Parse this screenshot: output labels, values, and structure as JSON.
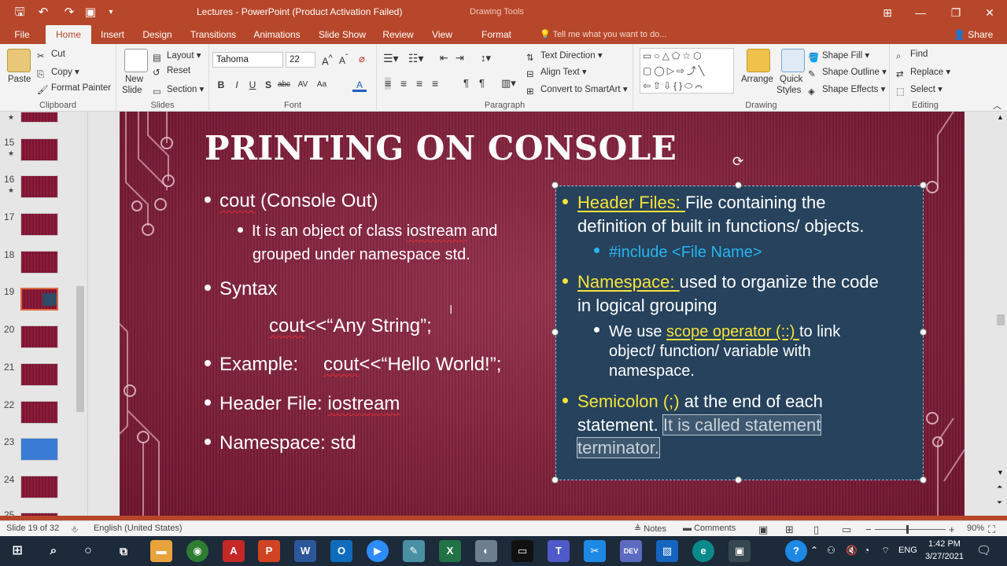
{
  "window": {
    "title": "Lectures - PowerPoint (Product Activation Failed)",
    "context_tab_group": "Drawing Tools",
    "controls": [
      "⊞",
      "—",
      "❐",
      "✕"
    ]
  },
  "tabs": [
    {
      "label": "File"
    },
    {
      "label": "Home"
    },
    {
      "label": "Insert"
    },
    {
      "label": "Design"
    },
    {
      "label": "Transitions"
    },
    {
      "label": "Animations"
    },
    {
      "label": "Slide Show"
    },
    {
      "label": "Review"
    },
    {
      "label": "View"
    },
    {
      "label": "Format"
    }
  ],
  "tell_me": "Tell me what you want to do...",
  "share": "Share",
  "ribbon": {
    "clipboard": {
      "paste": "Paste",
      "cut": "Cut",
      "copy": "Copy",
      "format_painter": "Format Painter",
      "label": "Clipboard"
    },
    "slides": {
      "new_slide": "New",
      "new_slide2": "Slide",
      "layout": "Layout",
      "reset": "Reset",
      "section": "Section",
      "label": "Slides"
    },
    "font": {
      "name": "Tahoma",
      "size": "22",
      "label": "Font"
    },
    "paragraph": {
      "text_direction": "Text Direction",
      "align_text": "Align Text",
      "smartart": "Convert to SmartArt",
      "label": "Paragraph"
    },
    "drawing": {
      "arrange": "Arrange",
      "quick_styles": "Quick",
      "quick_styles2": "Styles",
      "shape_fill": "Shape Fill",
      "shape_outline": "Shape Outline",
      "shape_effects": "Shape Effects",
      "label": "Drawing"
    },
    "editing": {
      "find": "Find",
      "replace": "Replace",
      "select": "Select",
      "label": "Editing"
    }
  },
  "thumbnails": [
    {
      "num": "15",
      "star": "★"
    },
    {
      "num": "16",
      "star": "★"
    },
    {
      "num": "17"
    },
    {
      "num": "18"
    },
    {
      "num": "19"
    },
    {
      "num": "20"
    },
    {
      "num": "21"
    },
    {
      "num": "22"
    },
    {
      "num": "23"
    },
    {
      "num": "24"
    },
    {
      "num": "25"
    }
  ],
  "selected_slide": "19",
  "slide": {
    "title": "PRINTING ON CONSOLE",
    "left": {
      "cout_word": "cout",
      "cout_rest": " (Console Out)",
      "obj_line1a": "It is an object of class ",
      "obj_line1b": "iostream",
      "obj_line1c": " and",
      "obj_line2": "grouped under namespace std.",
      "syntax": "Syntax",
      "syntax_code_a": "cout",
      "syntax_code_b": "<<“Any String”;",
      "example_label": "Example:",
      "example_code_a": "cout",
      "example_code_b": "<<“Hello World!”;",
      "header_label": "Header File: ",
      "header_value": "iostream",
      "namespace": "Namespace: std"
    },
    "right": {
      "hf_label": "Header Files: ",
      "hf_text1": "File containing the",
      "hf_text2": "definition of built in functions/ objects.",
      "include": "#include <File Name>",
      "ns_label": "Namespace: ",
      "ns_text1": "used to organize the code",
      "ns_text2": "in logical grouping",
      "scope_a": "We use ",
      "scope_b": "scope operator (::) ",
      "scope_c": "to link",
      "scope_2": "object/ function/ variable with",
      "scope_3": "namespace.",
      "semi_label": "Semicolon (;) ",
      "semi_text1": "at the end of each",
      "semi_text2": "statement. ",
      "semi_hl1": "It is called statement",
      "semi_hl2": "terminator."
    }
  },
  "status": {
    "slide_of": "Slide 19 of 32",
    "language": "English (United States)",
    "notes": "Notes",
    "comments": "Comments",
    "zoom": "90%"
  },
  "taskbar": {
    "time": "1:42 PM",
    "date": "3/27/2021",
    "lang": "ENG"
  }
}
